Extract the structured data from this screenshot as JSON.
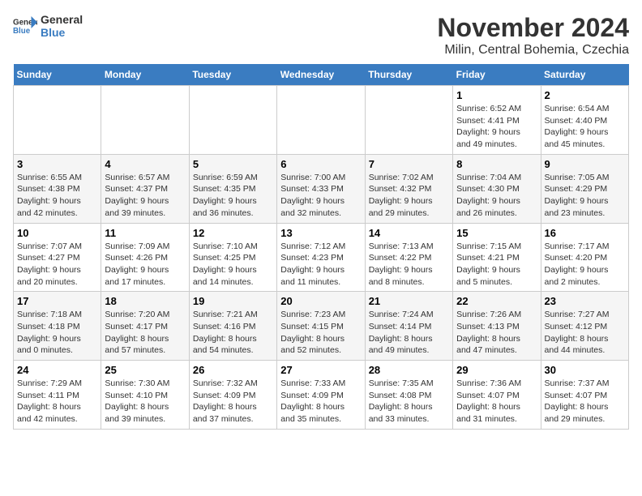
{
  "header": {
    "logo_line1": "General",
    "logo_line2": "Blue",
    "month_title": "November 2024",
    "subtitle": "Milin, Central Bohemia, Czechia"
  },
  "days_of_week": [
    "Sunday",
    "Monday",
    "Tuesday",
    "Wednesday",
    "Thursday",
    "Friday",
    "Saturday"
  ],
  "weeks": [
    [
      {
        "day": "",
        "info": ""
      },
      {
        "day": "",
        "info": ""
      },
      {
        "day": "",
        "info": ""
      },
      {
        "day": "",
        "info": ""
      },
      {
        "day": "",
        "info": ""
      },
      {
        "day": "1",
        "info": "Sunrise: 6:52 AM\nSunset: 4:41 PM\nDaylight: 9 hours\nand 49 minutes."
      },
      {
        "day": "2",
        "info": "Sunrise: 6:54 AM\nSunset: 4:40 PM\nDaylight: 9 hours\nand 45 minutes."
      }
    ],
    [
      {
        "day": "3",
        "info": "Sunrise: 6:55 AM\nSunset: 4:38 PM\nDaylight: 9 hours\nand 42 minutes."
      },
      {
        "day": "4",
        "info": "Sunrise: 6:57 AM\nSunset: 4:37 PM\nDaylight: 9 hours\nand 39 minutes."
      },
      {
        "day": "5",
        "info": "Sunrise: 6:59 AM\nSunset: 4:35 PM\nDaylight: 9 hours\nand 36 minutes."
      },
      {
        "day": "6",
        "info": "Sunrise: 7:00 AM\nSunset: 4:33 PM\nDaylight: 9 hours\nand 32 minutes."
      },
      {
        "day": "7",
        "info": "Sunrise: 7:02 AM\nSunset: 4:32 PM\nDaylight: 9 hours\nand 29 minutes."
      },
      {
        "day": "8",
        "info": "Sunrise: 7:04 AM\nSunset: 4:30 PM\nDaylight: 9 hours\nand 26 minutes."
      },
      {
        "day": "9",
        "info": "Sunrise: 7:05 AM\nSunset: 4:29 PM\nDaylight: 9 hours\nand 23 minutes."
      }
    ],
    [
      {
        "day": "10",
        "info": "Sunrise: 7:07 AM\nSunset: 4:27 PM\nDaylight: 9 hours\nand 20 minutes."
      },
      {
        "day": "11",
        "info": "Sunrise: 7:09 AM\nSunset: 4:26 PM\nDaylight: 9 hours\nand 17 minutes."
      },
      {
        "day": "12",
        "info": "Sunrise: 7:10 AM\nSunset: 4:25 PM\nDaylight: 9 hours\nand 14 minutes."
      },
      {
        "day": "13",
        "info": "Sunrise: 7:12 AM\nSunset: 4:23 PM\nDaylight: 9 hours\nand 11 minutes."
      },
      {
        "day": "14",
        "info": "Sunrise: 7:13 AM\nSunset: 4:22 PM\nDaylight: 9 hours\nand 8 minutes."
      },
      {
        "day": "15",
        "info": "Sunrise: 7:15 AM\nSunset: 4:21 PM\nDaylight: 9 hours\nand 5 minutes."
      },
      {
        "day": "16",
        "info": "Sunrise: 7:17 AM\nSunset: 4:20 PM\nDaylight: 9 hours\nand 2 minutes."
      }
    ],
    [
      {
        "day": "17",
        "info": "Sunrise: 7:18 AM\nSunset: 4:18 PM\nDaylight: 9 hours\nand 0 minutes."
      },
      {
        "day": "18",
        "info": "Sunrise: 7:20 AM\nSunset: 4:17 PM\nDaylight: 8 hours\nand 57 minutes."
      },
      {
        "day": "19",
        "info": "Sunrise: 7:21 AM\nSunset: 4:16 PM\nDaylight: 8 hours\nand 54 minutes."
      },
      {
        "day": "20",
        "info": "Sunrise: 7:23 AM\nSunset: 4:15 PM\nDaylight: 8 hours\nand 52 minutes."
      },
      {
        "day": "21",
        "info": "Sunrise: 7:24 AM\nSunset: 4:14 PM\nDaylight: 8 hours\nand 49 minutes."
      },
      {
        "day": "22",
        "info": "Sunrise: 7:26 AM\nSunset: 4:13 PM\nDaylight: 8 hours\nand 47 minutes."
      },
      {
        "day": "23",
        "info": "Sunrise: 7:27 AM\nSunset: 4:12 PM\nDaylight: 8 hours\nand 44 minutes."
      }
    ],
    [
      {
        "day": "24",
        "info": "Sunrise: 7:29 AM\nSunset: 4:11 PM\nDaylight: 8 hours\nand 42 minutes."
      },
      {
        "day": "25",
        "info": "Sunrise: 7:30 AM\nSunset: 4:10 PM\nDaylight: 8 hours\nand 39 minutes."
      },
      {
        "day": "26",
        "info": "Sunrise: 7:32 AM\nSunset: 4:09 PM\nDaylight: 8 hours\nand 37 minutes."
      },
      {
        "day": "27",
        "info": "Sunrise: 7:33 AM\nSunset: 4:09 PM\nDaylight: 8 hours\nand 35 minutes."
      },
      {
        "day": "28",
        "info": "Sunrise: 7:35 AM\nSunset: 4:08 PM\nDaylight: 8 hours\nand 33 minutes."
      },
      {
        "day": "29",
        "info": "Sunrise: 7:36 AM\nSunset: 4:07 PM\nDaylight: 8 hours\nand 31 minutes."
      },
      {
        "day": "30",
        "info": "Sunrise: 7:37 AM\nSunset: 4:07 PM\nDaylight: 8 hours\nand 29 minutes."
      }
    ]
  ]
}
